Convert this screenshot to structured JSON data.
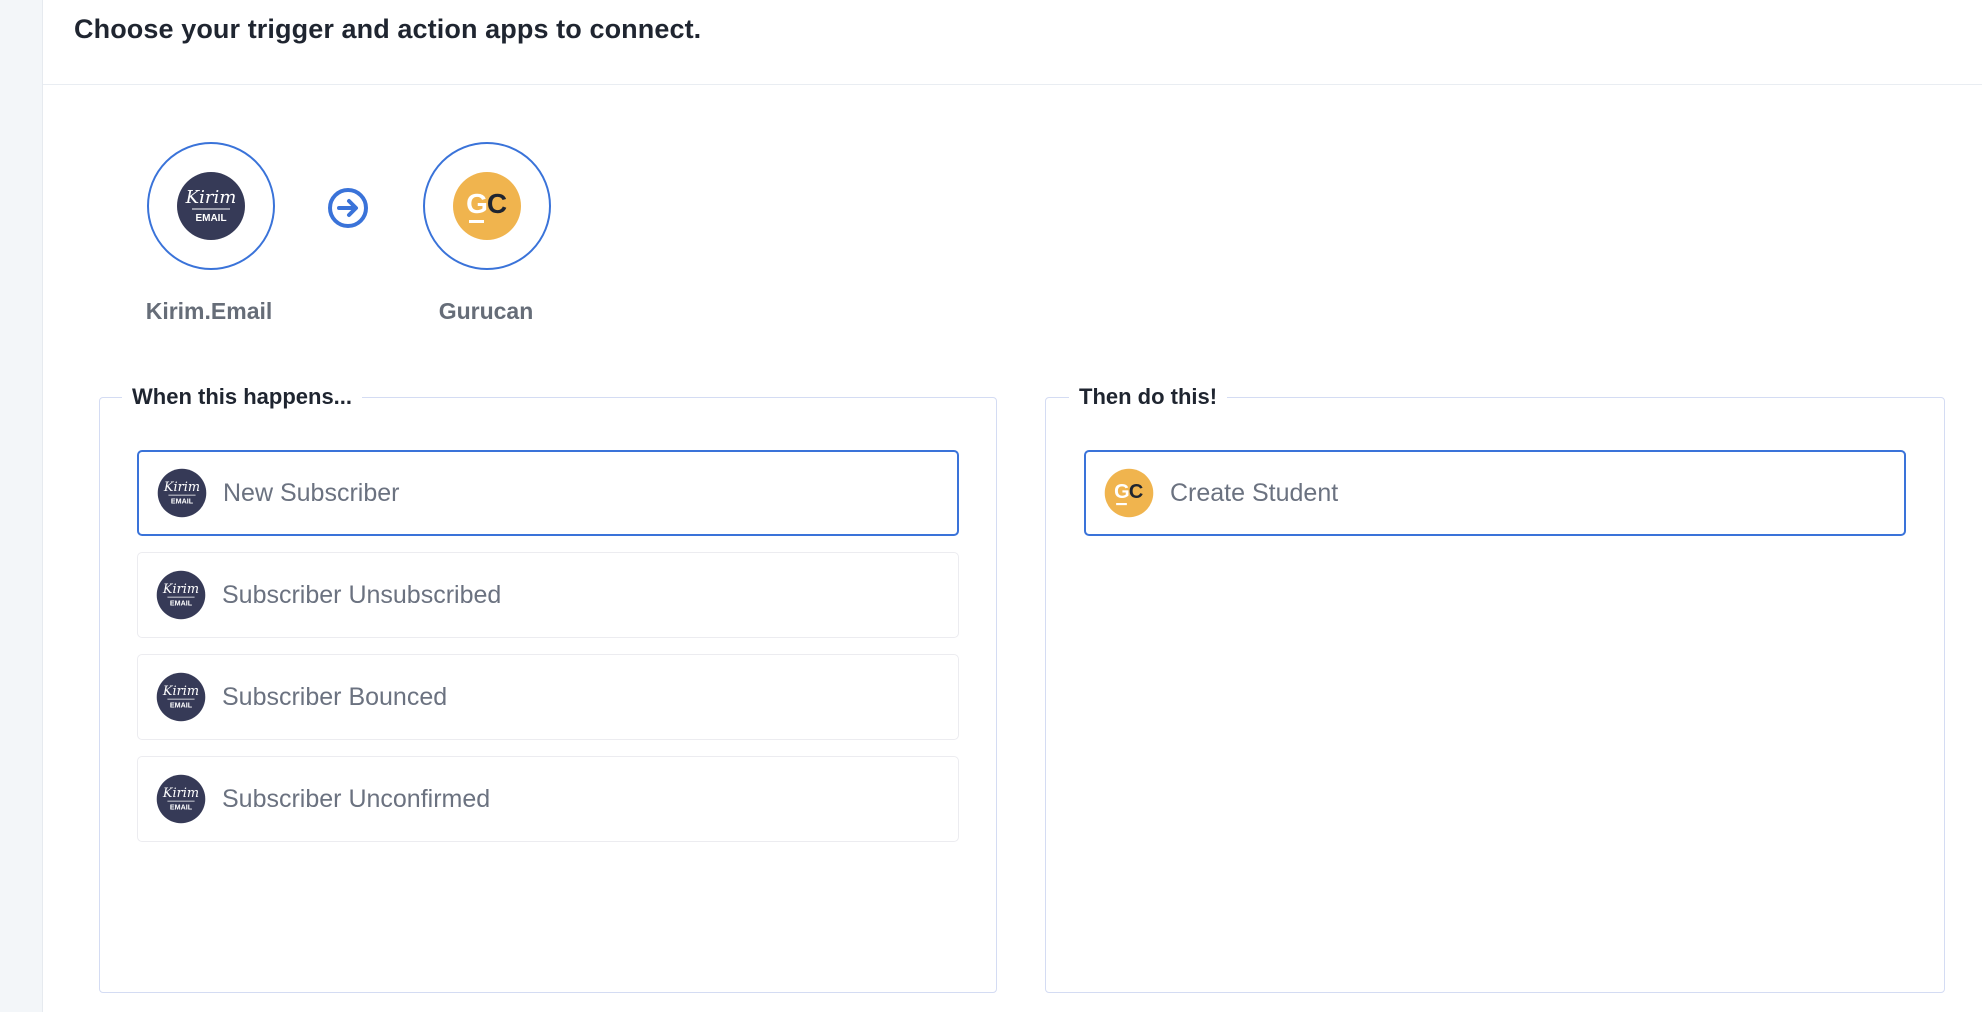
{
  "header": {
    "title": "Choose your trigger and action apps to connect."
  },
  "apps": {
    "trigger": {
      "name": "Kirim.Email",
      "logo_word": "Kirim",
      "logo_sub": "EMAIL",
      "color": "#363a57"
    },
    "action": {
      "name": "Gurucan",
      "logo_letters": [
        "G",
        "C"
      ],
      "color": "#f0b44e"
    },
    "arrow_color": "#3a73d9"
  },
  "trigger_panel": {
    "legend": "When this happens...",
    "options": [
      {
        "label": "New Subscriber",
        "selected": true
      },
      {
        "label": "Subscriber Unsubscribed",
        "selected": false
      },
      {
        "label": "Subscriber Bounced",
        "selected": false
      },
      {
        "label": "Subscriber Unconfirmed",
        "selected": false
      }
    ]
  },
  "action_panel": {
    "legend": "Then do this!",
    "options": [
      {
        "label": "Create Student",
        "selected": true
      }
    ]
  }
}
